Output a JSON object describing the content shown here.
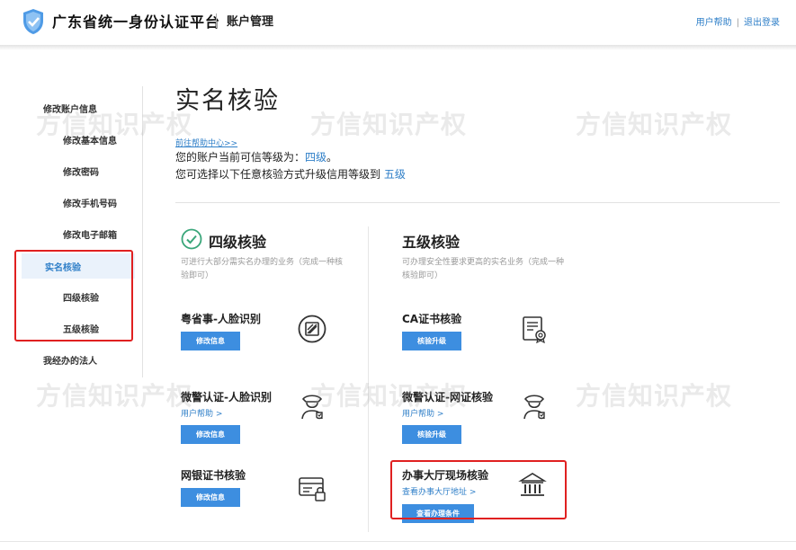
{
  "header": {
    "platform_name": "广东省统一身份认证平台",
    "section_name": "账户管理",
    "help_link": "用户帮助",
    "logout_link": "退出登录"
  },
  "sidebar": {
    "groups": [
      {
        "label": "修改账户信息"
      },
      {
        "label": "修改基本信息"
      },
      {
        "label": "修改密码"
      },
      {
        "label": "修改手机号码"
      },
      {
        "label": "修改电子邮箱"
      },
      {
        "label": "实名核验",
        "active": true
      },
      {
        "label": "四级核验"
      },
      {
        "label": "五级核验"
      },
      {
        "label": "我经办的法人"
      }
    ]
  },
  "main": {
    "title": "实名核验",
    "help_center_link": "前往帮助中心>>",
    "level_prefix": "您的账户当前可信等级为：",
    "level_value": "四级",
    "level_suffix": "。",
    "upgrade_prefix": "您可选择以下任意核验方式升级信用等级到 ",
    "upgrade_value": "五级",
    "level4": {
      "heading": "四级核验",
      "desc": "可进行大部分需实名办理的业务（完成一种核验即可）",
      "methods": [
        {
          "title": "粤省事-人脸识别",
          "button": "修改信息",
          "icon": "yueshengshi-icon"
        },
        {
          "title": "微警认证-人脸识别",
          "link": "用户帮助 >",
          "button": "修改信息",
          "icon": "police-officer-icon"
        },
        {
          "title": "网银证书核验",
          "button": "修改信息",
          "icon": "bank-card-lock-icon"
        }
      ]
    },
    "level5": {
      "heading": "五级核验",
      "desc": "可办理安全性要求更高的实名业务（完成一种核验即可）",
      "methods": [
        {
          "title": "CA证书核验",
          "button": "核验升级",
          "icon": "certificate-icon"
        },
        {
          "title": "微警认证-网证核验",
          "link": "用户帮助 >",
          "button": "核验升级",
          "icon": "police-officer-icon"
        },
        {
          "title": "办事大厅现场核验",
          "link": "查看办事大厅地址 >",
          "button": "查看办理条件",
          "icon": "government-hall-icon"
        }
      ]
    }
  },
  "watermark": "方信知识产权",
  "colors": {
    "accent": "#2f7fc8",
    "button": "#3d8ee0",
    "highlight_border": "#e02020"
  }
}
